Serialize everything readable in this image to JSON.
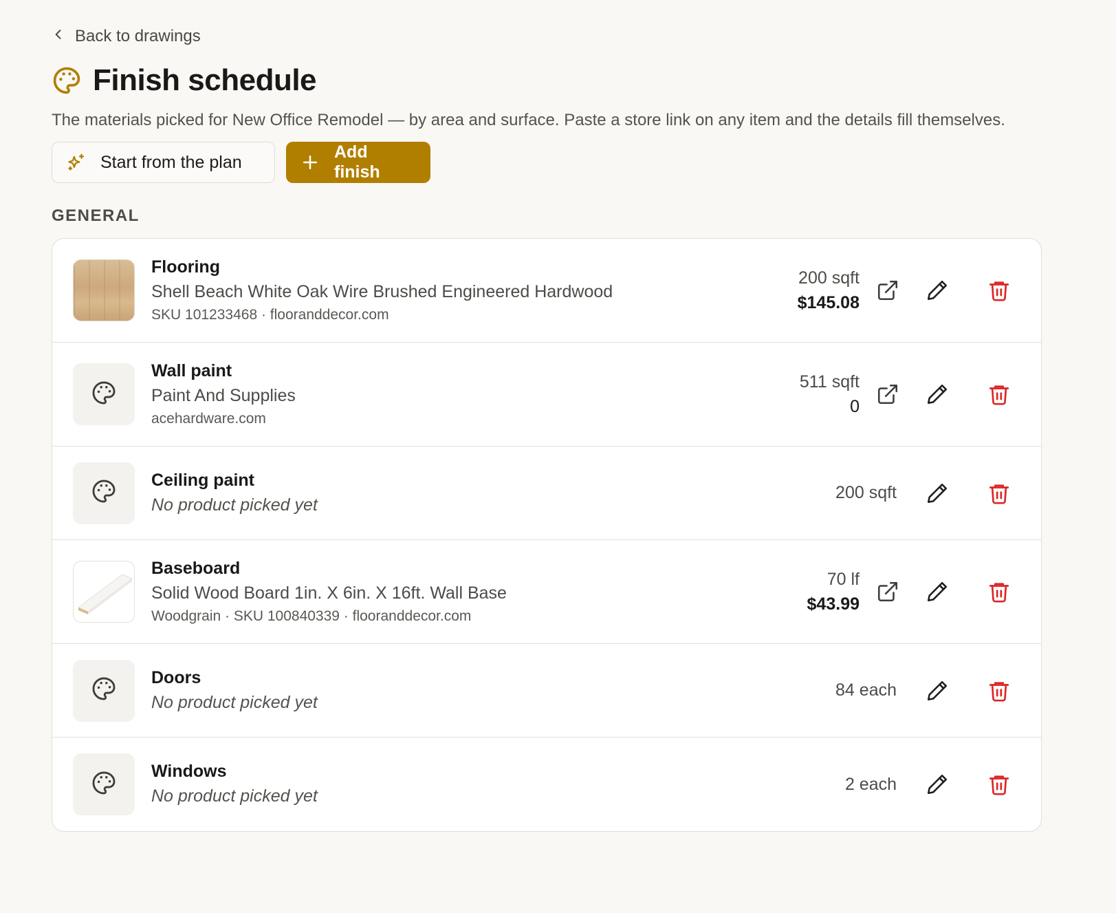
{
  "nav": {
    "back_label": "Back to drawings"
  },
  "header": {
    "title": "Finish schedule",
    "description": "The materials picked for New Office Remodel — by area and surface. Paste a store link on any item and the details fill themselves."
  },
  "actions": {
    "start_label": "Start from the plan",
    "add_label": "Add finish"
  },
  "section": {
    "label": "GENERAL"
  },
  "colors": {
    "accent": "#b07f00",
    "danger": "#dc2626",
    "background": "#f9f8f5"
  },
  "items": [
    {
      "name": "Flooring",
      "product": "Shell Beach White Oak Wire Brushed Engineered Hardwood",
      "meta": "SKU 101233468 · flooranddecor.com",
      "qty": "200 sqft",
      "price": "$145.08",
      "thumb": "wood-flooring-image"
    },
    {
      "name": "Wall paint",
      "product": "Paint And Supplies",
      "meta": "acehardware.com",
      "qty": "511 sqft",
      "price": "0",
      "thumb": "palette-icon"
    },
    {
      "name": "Ceiling paint",
      "product": "No product picked yet",
      "qty": "200 sqft",
      "thumb": "palette-icon"
    },
    {
      "name": "Baseboard",
      "product": "Solid Wood Board 1in. X 6in. X 16ft. Wall Base",
      "meta": "Woodgrain · SKU 100840339 · flooranddecor.com",
      "qty": "70 lf",
      "price": "$43.99",
      "thumb": "baseboard-image"
    },
    {
      "name": "Doors",
      "product": "No product picked yet",
      "qty": "84 each",
      "thumb": "palette-icon"
    },
    {
      "name": "Windows",
      "product": "No product picked yet",
      "qty": "2 each",
      "thumb": "palette-icon"
    }
  ]
}
